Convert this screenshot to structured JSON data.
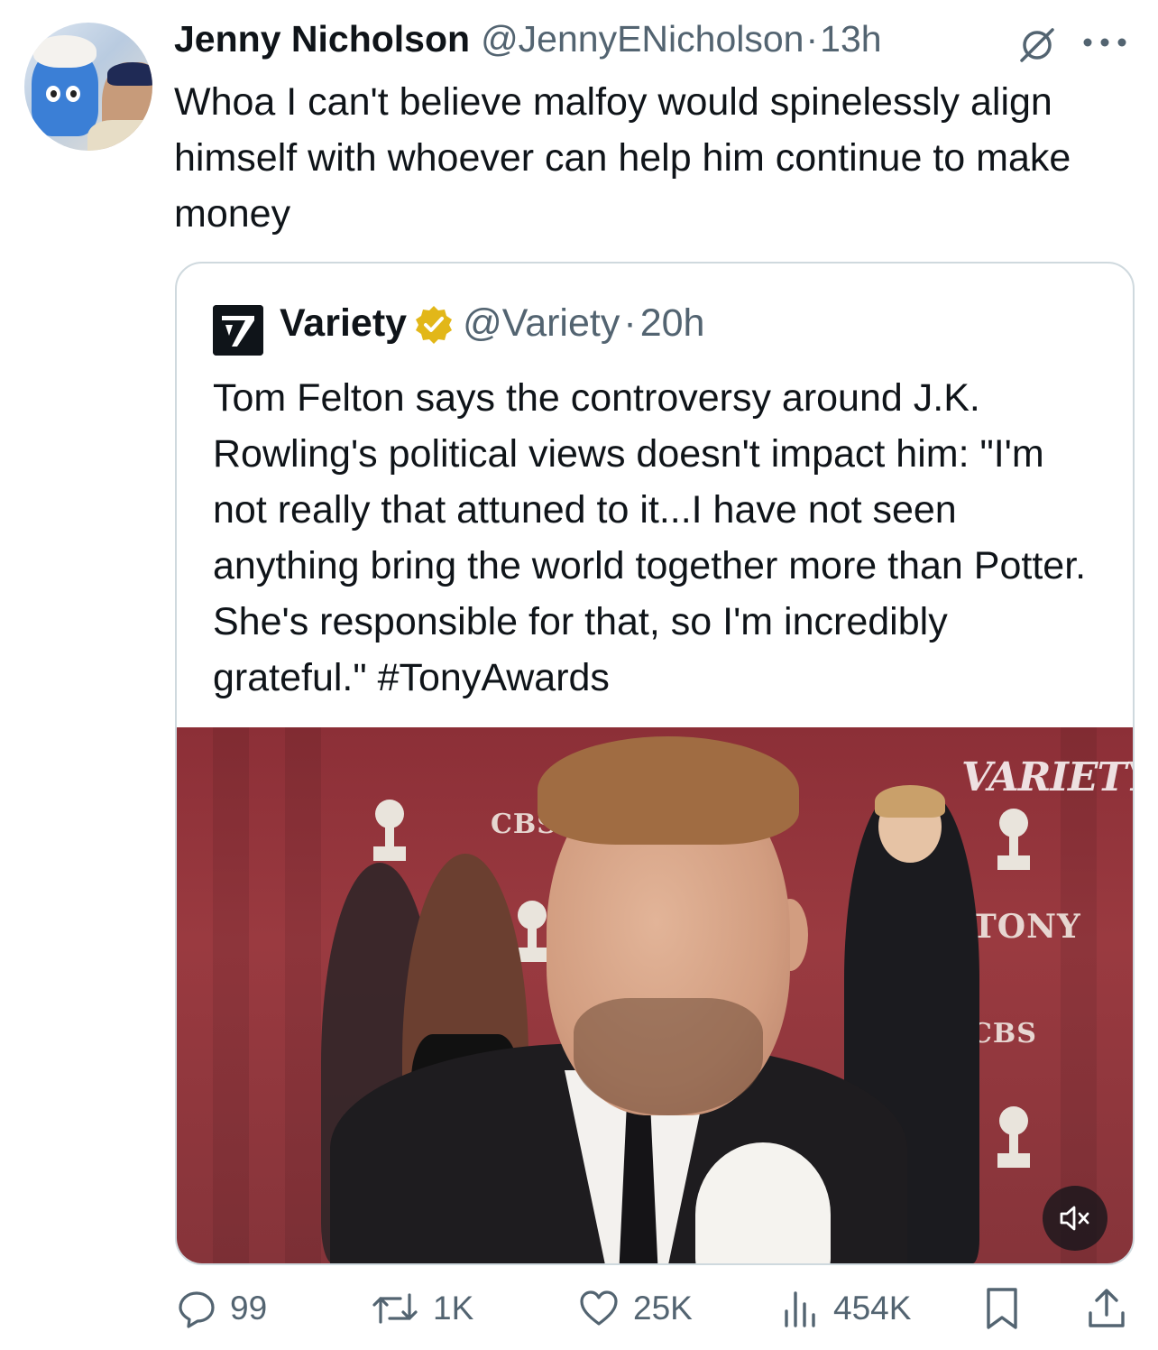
{
  "tweet": {
    "author_name": "Jenny Nicholson",
    "author_handle": "@JennyENicholson",
    "separator": "·",
    "time": "13h",
    "text": "Whoa I can't believe malfoy would spinelessly align himself with whoever can help him continue to make money",
    "icons": {
      "header_left": "no-edit-icon",
      "header_right": "more-icon"
    }
  },
  "quote": {
    "author_name": "Variety",
    "author_handle": "@Variety",
    "separator": "·",
    "time": "20h",
    "verified": true,
    "verified_color": "#e2b719",
    "text": "Tom Felton says the controversy around J.K. Rowling's political views doesn't impact him: \"I'm not really that attuned to it...I have not seen anything bring the world together more than Potter. She's responsible for that, so I'm incredibly grateful.\" #TonyAwards",
    "media": {
      "kind": "video",
      "watermark": "VARIETY",
      "backdrop_labels": [
        "CBS",
        "TONY",
        "CBS"
      ],
      "mute_icon": "speaker-muted-icon"
    }
  },
  "actions": {
    "reply": {
      "icon": "reply-icon",
      "count": "99"
    },
    "repost": {
      "icon": "repost-icon",
      "count": "1K"
    },
    "like": {
      "icon": "heart-icon",
      "count": "25K"
    },
    "views": {
      "icon": "views-icon",
      "count": "454K"
    },
    "bookmark": {
      "icon": "bookmark-icon"
    },
    "share": {
      "icon": "share-icon"
    }
  },
  "colors": {
    "text_primary": "#0f1419",
    "text_secondary": "#536471",
    "border": "#cfd9de",
    "backdrop": "#8c2f37"
  }
}
